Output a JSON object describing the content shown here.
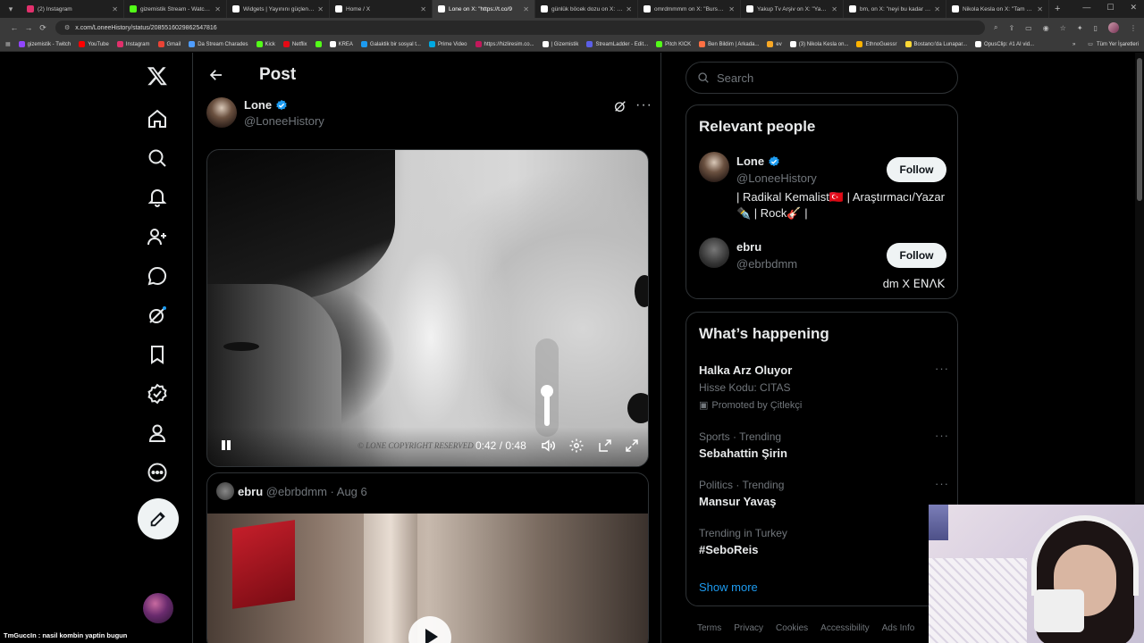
{
  "browser": {
    "tabs": [
      {
        "label": "(2) Instagram",
        "color": "#e1306c"
      },
      {
        "label": "gizemistik Stream - Watch Liv",
        "color": "#53fc18"
      },
      {
        "label": "Widgets | Yayınını güçlendiren",
        "color": "#ffffff"
      },
      {
        "label": "Home / X",
        "color": "#ffffff"
      },
      {
        "label": "Lone on X: \"https://t.co/9",
        "color": "#ffffff",
        "active": true
      },
      {
        "label": "günlük böcek dozu on X: \"ins",
        "color": "#ffffff"
      },
      {
        "label": "omrdmmmm on X: \"Bursaspo",
        "color": "#ffffff"
      },
      {
        "label": "Yakup Tv Arşiv on X: \"Yakup T",
        "color": "#ffffff"
      },
      {
        "label": "bm, on X: \"neyi bu kadar büyü",
        "color": "#ffffff"
      },
      {
        "label": "Nikola Kesla on X: \"Tam ben o",
        "color": "#ffffff"
      }
    ],
    "url": "x.com/LoneeHistory/status/2085516029862547816",
    "bookmarks": [
      {
        "label": "gizemistik - Twitch",
        "color": "#9146ff"
      },
      {
        "label": "YouTube",
        "color": "#ff0000"
      },
      {
        "label": "Instagram",
        "color": "#e1306c"
      },
      {
        "label": "Gmail",
        "color": "#ea4335"
      },
      {
        "label": "Da Stream Charades",
        "color": "#4f9dff"
      },
      {
        "label": "Kick",
        "color": "#53fc18"
      },
      {
        "label": "Netflix",
        "color": "#e50914"
      },
      {
        "label": "",
        "color": "#53fc18"
      },
      {
        "label": "KREA",
        "color": "#ffffff"
      },
      {
        "label": "Galaktik bir sosyal t...",
        "color": "#1d9bf0"
      },
      {
        "label": "Prime Video",
        "color": "#00a8e1"
      },
      {
        "label": "https://hizliresim.co...",
        "color": "#c2185b"
      },
      {
        "label": "| Gizemistik",
        "color": "#ffffff"
      },
      {
        "label": "StreamLadder - Edit...",
        "color": "#5b5fe6"
      },
      {
        "label": "Pitch KICK",
        "color": "#53fc18"
      },
      {
        "label": "Ben Bildim | Arkada...",
        "color": "#ff7043"
      },
      {
        "label": "ev",
        "color": "#f9a825"
      },
      {
        "label": "(3) Nikola Kesla on...",
        "color": "#ffffff"
      },
      {
        "label": "EthnoGuessr",
        "color": "#ffb300"
      },
      {
        "label": "Bostancı'da Lunapar...",
        "color": "#fdd835"
      },
      {
        "label": "OpusClip: #1 AI vid...",
        "color": "#ffffff"
      }
    ],
    "all_bookmarks": "Tüm Yer İşaretleri"
  },
  "nav": {
    "items": [
      "home",
      "explore",
      "notifications",
      "follow",
      "chat",
      "grok",
      "bookmarks",
      "verified",
      "profile",
      "more"
    ]
  },
  "post_page": {
    "title": "Post",
    "author": {
      "name": "Lone",
      "handle": "@LoneeHistory"
    },
    "video": {
      "time_current": "0:42",
      "time_total": "0:48",
      "separator": "/",
      "watermark": "© LONE COPYRIGHT RESERVED",
      "volume_level": 0.45
    },
    "reply": {
      "name": "ebru",
      "handle": "@ebrbdmm",
      "date": "Aug 6"
    }
  },
  "sidebar": {
    "search_placeholder": "Search",
    "relevant_people": {
      "title": "Relevant people",
      "people": [
        {
          "name": "Lone",
          "handle": "@LoneeHistory",
          "bio": "| Radikal Kemalist🇹🇷 | Araştırmacı/Yazar ✒️ | Rock🎸 |",
          "follow": "Follow",
          "verified": true
        },
        {
          "name": "ebru",
          "handle": "@ebrbdmm",
          "bio": "dm X ꓰꓠꓥꓗ",
          "follow": "Follow",
          "verified": false
        }
      ]
    },
    "whats_happening": {
      "title": "What’s happening",
      "trends": [
        {
          "context": "",
          "name": "Halka Arz Oluyor",
          "sub": "Hisse Kodu: CITAS",
          "promoted": "Promoted by Çitlekçi"
        },
        {
          "context": "Sports · Trending",
          "name": "Sebahattin Şirin"
        },
        {
          "context": "Politics · Trending",
          "name": "Mansur Yavaş"
        },
        {
          "context": "Trending in Turkey",
          "name": "#SeboReis"
        }
      ],
      "show_more": "Show more"
    },
    "footer": [
      "Terms",
      "Privacy",
      "Cookies",
      "Accessibility",
      "Ads Info"
    ]
  },
  "stream_overlay": {
    "chat_line": "TmGuccIn : nasil kombin yaptin bugun"
  },
  "colors": {
    "accent": "#1d9bf0",
    "background": "#000000",
    "text": "#e7e9ea",
    "muted": "#71767b",
    "border": "#2f3336"
  }
}
